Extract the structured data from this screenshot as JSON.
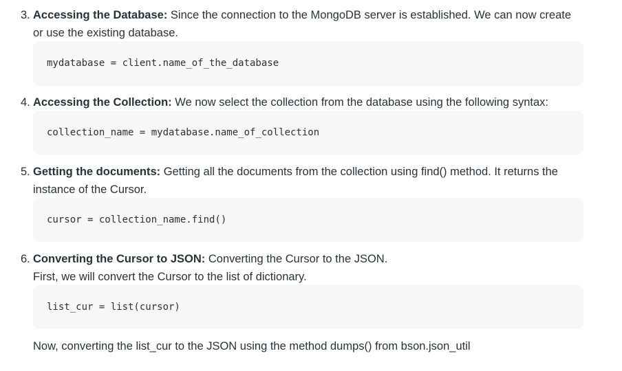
{
  "steps": [
    {
      "number": "3.",
      "heading": "Accessing the Database:",
      "text_line1": " Since the connection to the MongoDB server is established. We can now create",
      "text_line2": "or use the existing database.",
      "code": "mydatabase = client.name_of_the_database"
    },
    {
      "number": "4.",
      "heading": "Accessing the Collection:",
      "text_line1": " We now select the collection from the database using the following syntax:",
      "code": "collection_name = mydatabase.name_of_collection"
    },
    {
      "number": "5.",
      "heading": "Getting the documents:",
      "text_line1": " Getting all the documents from the collection using find() method. It returns the",
      "text_line2": "instance of the Cursor.",
      "code": "cursor = collection_name.find()"
    },
    {
      "number": "6.",
      "heading": "Converting the Cursor to JSON:",
      "text_line1": " Converting the Cursor to the JSON.",
      "text_line2": "First, we will convert the Cursor to the list of dictionary.",
      "code": "list_cur = list(cursor)",
      "after_text": "Now, converting the list_cur to the JSON using the method dumps() from bson.json_util"
    }
  ]
}
